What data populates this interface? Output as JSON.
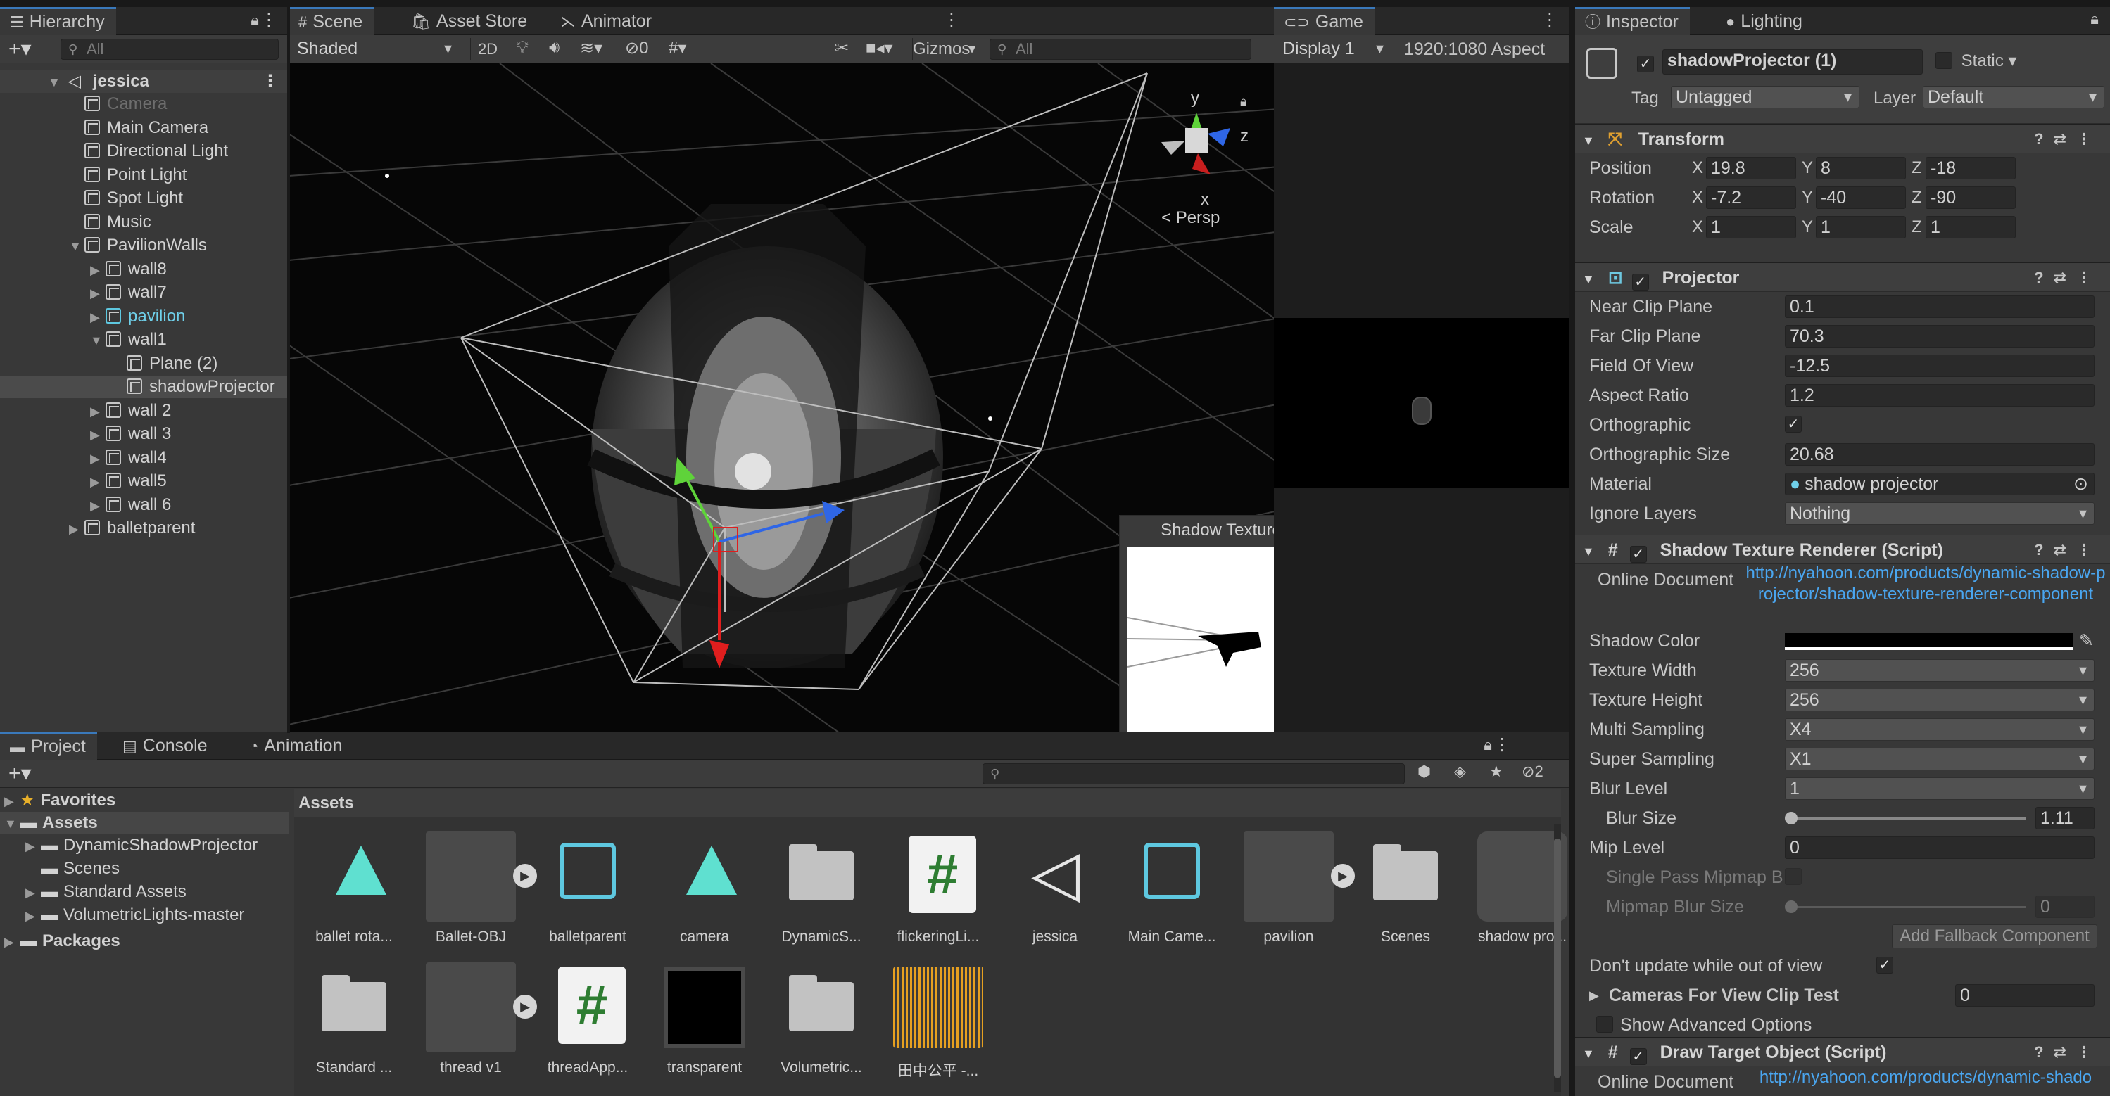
{
  "hierarchy": {
    "tab_label": "Hierarchy",
    "search_placeholder": "All",
    "scene_name": "jessica",
    "items": [
      {
        "label": "Camera",
        "dim": true
      },
      {
        "label": "Main Camera"
      },
      {
        "label": "Directional Light"
      },
      {
        "label": "Point Light"
      },
      {
        "label": "Spot Light"
      },
      {
        "label": "Music"
      },
      {
        "label": "PavilionWalls"
      },
      {
        "label": "wall8"
      },
      {
        "label": "wall7"
      },
      {
        "label": "pavilion"
      },
      {
        "label": "wall1"
      },
      {
        "label": "Plane (2)"
      },
      {
        "label": "shadowProjector"
      },
      {
        "label": "wall 2"
      },
      {
        "label": "wall 3"
      },
      {
        "label": "wall4"
      },
      {
        "label": "wall5"
      },
      {
        "label": "wall 6"
      },
      {
        "label": "balletparent"
      }
    ]
  },
  "scene": {
    "tabs": {
      "scene": "Scene",
      "asset_store": "Asset Store",
      "animator": "Animator"
    },
    "shading": "Shaded",
    "mode_2d": "2D",
    "hidden_count": "0",
    "gizmos": "Gizmos",
    "search_placeholder": "All",
    "persp": "Persp",
    "gizmo_axes": {
      "y": "y",
      "z": "z",
      "x": "x"
    },
    "overlay_title": "Shadow Texture"
  },
  "game": {
    "tab_label": "Game",
    "display": "Display 1",
    "aspect": "1920:1080 Aspect"
  },
  "inspector": {
    "tabs": {
      "inspector": "Inspector",
      "lighting": "Lighting"
    },
    "object_name": "shadowProjector (1)",
    "static_label": "Static",
    "tag_label": "Tag",
    "tag_value": "Untagged",
    "layer_label": "Layer",
    "layer_value": "Default",
    "transform": {
      "title": "Transform",
      "position_label": "Position",
      "position": {
        "x": "19.8",
        "y": "8",
        "z": "-18"
      },
      "rotation_label": "Rotation",
      "rotation": {
        "x": "-7.2",
        "y": "-40",
        "z": "-90"
      },
      "scale_label": "Scale",
      "scale": {
        "x": "1",
        "y": "1",
        "z": "1"
      }
    },
    "projector": {
      "title": "Projector",
      "near_label": "Near Clip Plane",
      "near": "0.1",
      "far_label": "Far Clip Plane",
      "far": "70.3",
      "fov_label": "Field Of View",
      "fov": "-12.5",
      "aspect_label": "Aspect Ratio",
      "aspect": "1.2",
      "ortho_label": "Orthographic",
      "ortho_size_label": "Orthographic Size",
      "ortho_size": "20.68",
      "material_label": "Material",
      "material": "shadow projector",
      "ignore_label": "Ignore Layers",
      "ignore": "Nothing"
    },
    "shadow_renderer": {
      "title": "Shadow Texture Renderer (Script)",
      "online_doc_label": "Online Document",
      "online_doc_link": "http://nyahoon.com/products/dynamic-shadow-projector/shadow-texture-renderer-component",
      "shadow_color_label": "Shadow Color",
      "tex_width_label": "Texture Width",
      "tex_width": "256",
      "tex_height_label": "Texture Height",
      "tex_height": "256",
      "multi_label": "Multi Sampling",
      "multi": "X4",
      "super_label": "Super Sampling",
      "super": "X1",
      "blur_level_label": "Blur Level",
      "blur_level": "1",
      "blur_size_label": "Blur Size",
      "blur_size": "1.11",
      "mip_label": "Mip Level",
      "mip": "0",
      "single_pass_label": "Single Pass Mipmap B",
      "mip_blur_label": "Mipmap Blur Size",
      "mip_blur": "0",
      "fallback_button": "Add Fallback Component",
      "dont_update_label": "Don't update while out of view",
      "cameras_label": "Cameras For View Clip Test",
      "cameras": "0",
      "advanced_label": "Show Advanced Options"
    },
    "draw_target": {
      "title": "Draw Target Object (Script)",
      "online_doc_label": "Online Document",
      "online_doc_link": "http://nyahoon.com/products/dynamic-shado"
    }
  },
  "project": {
    "tabs": {
      "project": "Project",
      "console": "Console",
      "animation": "Animation"
    },
    "hidden_count": "2",
    "tree": {
      "favorites": "Favorites",
      "assets": "Assets",
      "children": [
        "DynamicShadowProjector",
        "Scenes",
        "Standard Assets",
        "VolumetricLights-master"
      ],
      "packages": "Packages"
    },
    "breadcrumb": "Assets",
    "assets": [
      {
        "label": "ballet rota...",
        "kind": "anim"
      },
      {
        "label": "Ballet-OBJ",
        "kind": "model"
      },
      {
        "label": "balletparent",
        "kind": "prefab"
      },
      {
        "label": "camera",
        "kind": "anim"
      },
      {
        "label": "DynamicS...",
        "kind": "folder"
      },
      {
        "label": "flickeringLi...",
        "kind": "script"
      },
      {
        "label": "jessica",
        "kind": "unity"
      },
      {
        "label": "Main Came...",
        "kind": "prefab"
      },
      {
        "label": "pavilion",
        "kind": "model"
      },
      {
        "label": "Scenes",
        "kind": "folder"
      },
      {
        "label": "shadow pro...",
        "kind": "material"
      },
      {
        "label": "Standard ...",
        "kind": "folder"
      },
      {
        "label": "thread v1",
        "kind": "model"
      },
      {
        "label": "threadApp...",
        "kind": "script"
      },
      {
        "label": "transparent",
        "kind": "texture"
      },
      {
        "label": "Volumetric...",
        "kind": "folder"
      },
      {
        "label": "田中公平 -...",
        "kind": "audio"
      }
    ]
  },
  "colors": {
    "accent": "#3a79bb",
    "link": "#4aa6f0",
    "prefab": "#5ec8e0",
    "selection": "#2c5d87"
  }
}
